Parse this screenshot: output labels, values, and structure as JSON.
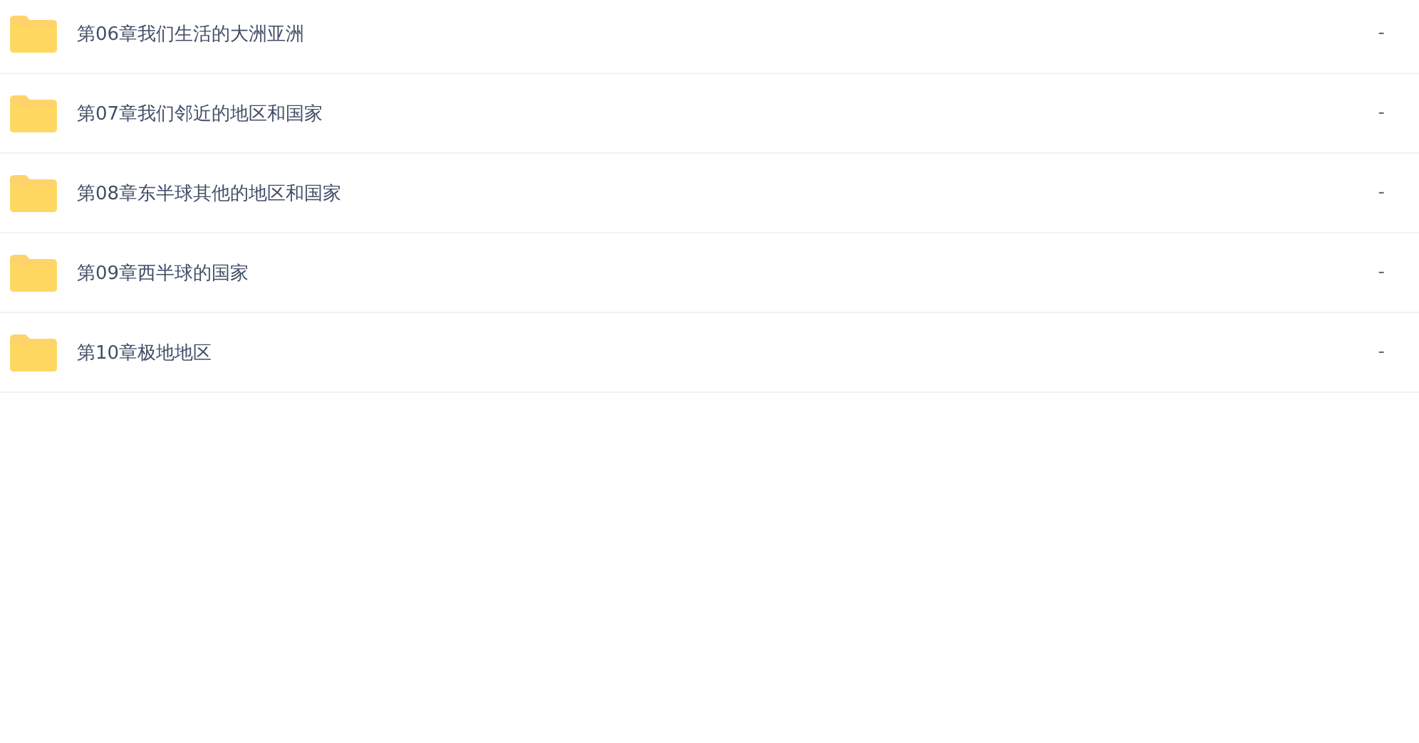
{
  "files": [
    {
      "name": "第06章我们生活的大洲亚洲",
      "size": "-"
    },
    {
      "name": "第07章我们邻近的地区和国家",
      "size": "-"
    },
    {
      "name": "第08章东半球其他的地区和国家",
      "size": "-"
    },
    {
      "name": "第09章西半球的国家",
      "size": "-"
    },
    {
      "name": "第10章极地地区",
      "size": "-"
    }
  ]
}
